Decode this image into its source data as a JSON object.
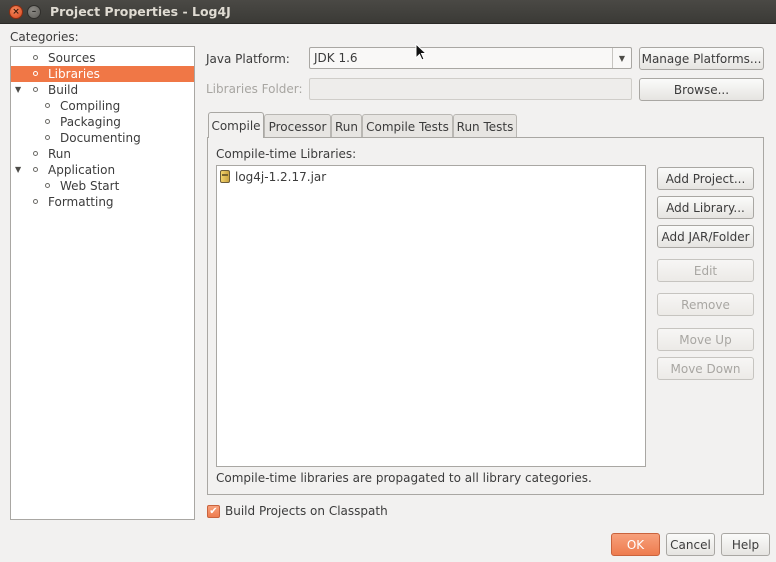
{
  "window": {
    "title": "Project Properties - Log4J",
    "close_glyph": "×",
    "min_glyph": "–"
  },
  "categories": {
    "label": "Categories:",
    "items": [
      {
        "label": "Sources",
        "level": 1,
        "selected": false,
        "expander": ""
      },
      {
        "label": "Libraries",
        "level": 1,
        "selected": true,
        "expander": ""
      },
      {
        "label": "Build",
        "level": 1,
        "selected": false,
        "expander": "▼"
      },
      {
        "label": "Compiling",
        "level": 2,
        "selected": false,
        "expander": ""
      },
      {
        "label": "Packaging",
        "level": 2,
        "selected": false,
        "expander": ""
      },
      {
        "label": "Documenting",
        "level": 2,
        "selected": false,
        "expander": ""
      },
      {
        "label": "Run",
        "level": 1,
        "selected": false,
        "expander": ""
      },
      {
        "label": "Application",
        "level": 1,
        "selected": false,
        "expander": "▼"
      },
      {
        "label": "Web Start",
        "level": 2,
        "selected": false,
        "expander": ""
      },
      {
        "label": "Formatting",
        "level": 1,
        "selected": false,
        "expander": ""
      }
    ]
  },
  "platform": {
    "label": "Java Platform:",
    "value": "JDK 1.6",
    "manage_label": "Manage Platforms...",
    "drop_glyph": "▼"
  },
  "libraries_folder": {
    "label": "Libraries Folder:",
    "value": "",
    "browse_label": "Browse..."
  },
  "tabs": [
    {
      "label": "Compile",
      "active": true
    },
    {
      "label": "Processor",
      "active": false
    },
    {
      "label": "Run",
      "active": false
    },
    {
      "label": "Compile Tests",
      "active": false
    },
    {
      "label": "Run Tests",
      "active": false
    }
  ],
  "compile": {
    "list_label": "Compile-time Libraries:",
    "libraries": [
      "log4j-1.2.17.jar"
    ],
    "footer_note": "Compile-time libraries are propagated to all library categories.",
    "buttons": [
      {
        "label": "Add Project...",
        "enabled": true
      },
      {
        "label": "Add Library...",
        "enabled": true
      },
      {
        "label": "Add JAR/Folder",
        "enabled": true
      },
      {
        "label": "Edit",
        "enabled": false
      },
      {
        "label": "Remove",
        "enabled": false
      },
      {
        "label": "Move Up",
        "enabled": false
      },
      {
        "label": "Move Down",
        "enabled": false
      }
    ]
  },
  "build_on_classpath": {
    "label": "Build Projects on Classpath",
    "checked": true,
    "check_glyph": "✔"
  },
  "footer": {
    "ok_label": "OK",
    "cancel_label": "Cancel",
    "help_label": "Help"
  },
  "colors": {
    "accent": "#f07746",
    "titlebar": "#3b3a36"
  }
}
